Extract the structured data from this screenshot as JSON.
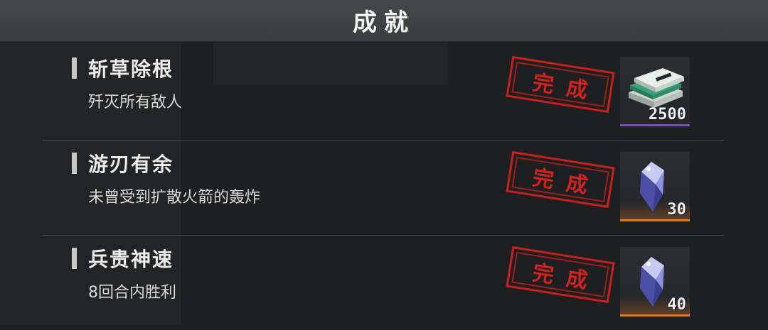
{
  "header": {
    "title": "成就"
  },
  "achievements": [
    {
      "title": "斩草除根",
      "description": "歼灭所有敌人",
      "status": "完成",
      "reward": {
        "icon": "cash-stack-icon",
        "count": "2500",
        "accent": "#7a4fb5"
      }
    },
    {
      "title": "游刃有余",
      "description": "未曾受到扩散火箭的轰炸",
      "status": "完成",
      "reward": {
        "icon": "crystal-icon",
        "count": "30",
        "accent": "#e57a22"
      }
    },
    {
      "title": "兵贵神速",
      "description": "8回合内胜利",
      "status": "完成",
      "reward": {
        "icon": "crystal-icon",
        "count": "40",
        "accent": "#e57a22"
      }
    }
  ],
  "colors": {
    "stamp": "#c8201e",
    "background": "#1d1f20",
    "header": "#424546"
  }
}
